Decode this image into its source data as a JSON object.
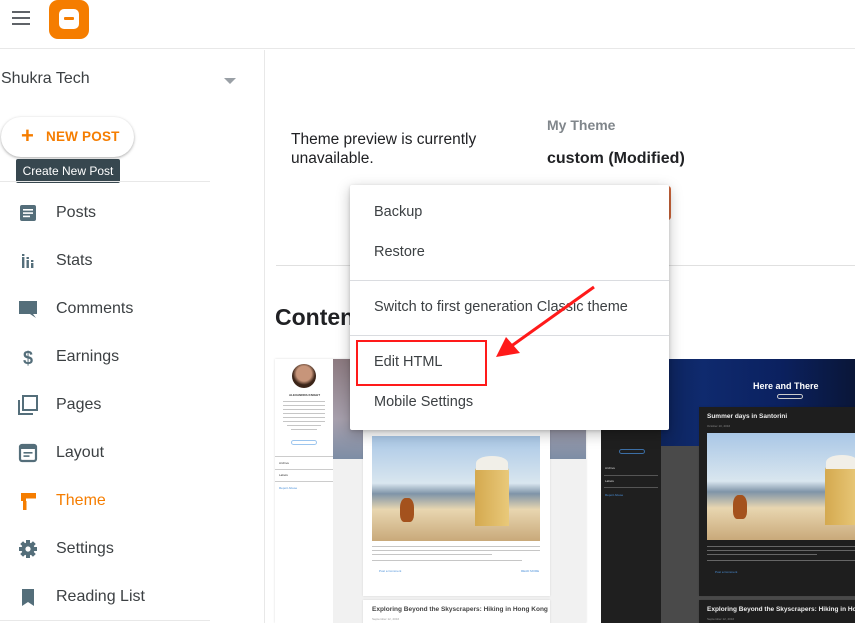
{
  "app": {
    "name": "Blogger",
    "brand_color": "#f57d00",
    "icons": {
      "menu": "hamburger-menu-icon",
      "logo": "blogger-logo-icon"
    }
  },
  "sidebar": {
    "blog_name": "Shukra Tech",
    "new_post_label": "NEW POST",
    "new_post_tooltip": "Create New Post",
    "active_item": "Theme",
    "items": [
      {
        "label": "Posts",
        "icon": "posts-icon"
      },
      {
        "label": "Stats",
        "icon": "stats-icon"
      },
      {
        "label": "Comments",
        "icon": "comments-icon"
      },
      {
        "label": "Earnings",
        "icon": "dollar-icon"
      },
      {
        "label": "Pages",
        "icon": "pages-icon"
      },
      {
        "label": "Layout",
        "icon": "layout-icon"
      },
      {
        "label": "Theme",
        "icon": "paint-roller-icon"
      },
      {
        "label": "Settings",
        "icon": "gear-icon"
      },
      {
        "label": "Reading List",
        "icon": "bookmark-icon"
      }
    ]
  },
  "main": {
    "preview_message": "Theme preview is currently unavailable.",
    "my_theme_label": "My Theme",
    "my_theme_name": "custom (Modified)",
    "section_heading": "Contempo",
    "section_heading_visible": "Conten",
    "theme_thumbnails": [
      {
        "variant": "light",
        "profile_name": "ALEXANDRA KNIGHT",
        "sidebar_links": [
          "Archive",
          "Labels"
        ],
        "report_abuse": "Report Abuse",
        "post_footer_link": "Post a Comment",
        "read_more": "READ MORE",
        "next_post_title": "Exploring Beyond the Skyscrapers: Hiking in Hong Kong",
        "next_post_date": "September 12, 2016"
      },
      {
        "variant": "dark",
        "blog_title": "Here and There",
        "subscribe": "SUBSCRIBE",
        "post_title": "Summer days in Santorini",
        "post_date": "October 10, 2016",
        "sidebar_links": [
          "Archive",
          "Labels"
        ],
        "report_abuse": "Report Abuse",
        "post_footer_link": "Post a Comment",
        "next_post_title": "Exploring Beyond the Skyscrapers: Hiking in Hong Kong",
        "next_post_date": "September 12, 2016"
      }
    ]
  },
  "dropdown_menu": {
    "items": [
      {
        "label": "Backup"
      },
      {
        "label": "Restore"
      },
      {
        "label": "Switch to first generation Classic theme"
      },
      {
        "label": "Edit HTML",
        "highlighted": true
      },
      {
        "label": "Mobile Settings"
      }
    ]
  },
  "annotation": {
    "color": "#ff1a1a",
    "target": "Edit HTML"
  }
}
